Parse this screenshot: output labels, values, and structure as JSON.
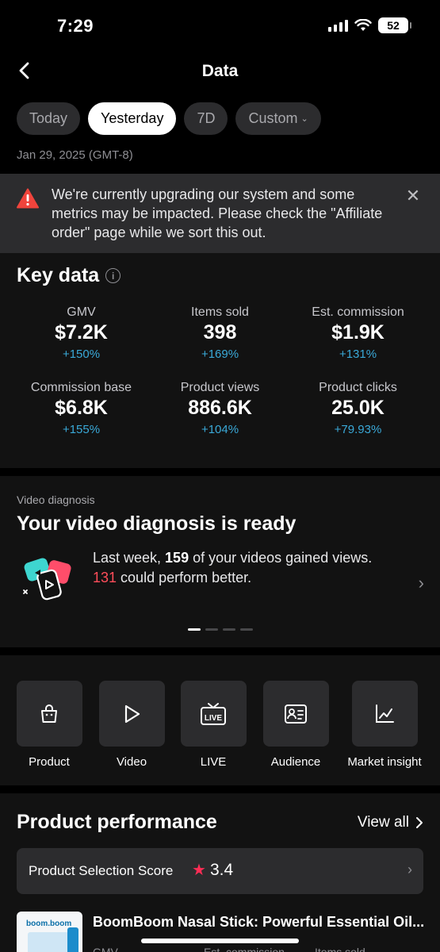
{
  "status_bar": {
    "time": "7:29",
    "battery": "52"
  },
  "header": {
    "title": "Data"
  },
  "tabs": [
    {
      "label": "Today",
      "active": false
    },
    {
      "label": "Yesterday",
      "active": true
    },
    {
      "label": "7D",
      "active": false
    },
    {
      "label": "Custom",
      "active": false
    }
  ],
  "date_label": "Jan 29, 2025 (GMT-8)",
  "banner": {
    "message": "We're currently upgrading our system and some metrics may be impacted. Please check the \"Affiliate order\" page while we sort this out."
  },
  "key_data": {
    "title": "Key data",
    "metrics": [
      {
        "label": "GMV",
        "value": "$7.2K",
        "change": "+150%"
      },
      {
        "label": "Items sold",
        "value": "398",
        "change": "+169%"
      },
      {
        "label": "Est. commission",
        "value": "$1.9K",
        "change": "+131%"
      },
      {
        "label": "Commission base",
        "value": "$6.8K",
        "change": "+155%"
      },
      {
        "label": "Product views",
        "value": "886.6K",
        "change": "+104%"
      },
      {
        "label": "Product clicks",
        "value": "25.0K",
        "change": "+79.93%"
      }
    ]
  },
  "video_diagnosis": {
    "kicker": "Video diagnosis",
    "title": "Your video diagnosis is ready",
    "text_1": "Last week, ",
    "gained_count": "159",
    "text_2": " of your videos gained views. ",
    "better_count": "131",
    "text_3": " could perform better."
  },
  "shortcuts": [
    {
      "label": "Product",
      "icon": "shopping-bag-icon"
    },
    {
      "label": "Video",
      "icon": "play-icon"
    },
    {
      "label": "LIVE",
      "icon": "live-tv-icon"
    },
    {
      "label": "Audience",
      "icon": "id-card-icon"
    },
    {
      "label": "Market insight",
      "icon": "line-chart-icon"
    }
  ],
  "product_performance": {
    "title": "Product performance",
    "view_all": "View all",
    "score_label": "Product Selection Score",
    "score_value": "3.4",
    "product_name": "BoomBoom Nasal Stick: Powerful Essential Oil...",
    "product_logo": "boom.boom",
    "columns": [
      "GMV",
      "Est. commission",
      "Items sold"
    ]
  },
  "colors": {
    "accent_positive": "#3aa9d8",
    "highlight_red": "#ff4d5a",
    "warning": "#f0443c",
    "star": "#ff2d55"
  }
}
